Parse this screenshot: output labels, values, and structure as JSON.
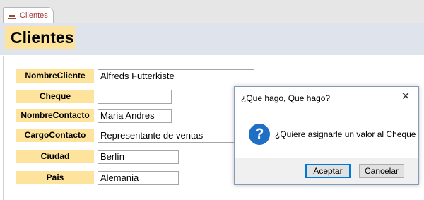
{
  "tab": {
    "label": "Clientes"
  },
  "form": {
    "title": "Clientes",
    "fields": [
      {
        "label": "NombreCliente",
        "value": "Alfreds Futterkiste"
      },
      {
        "label": "Cheque",
        "value": ""
      },
      {
        "label": "NombreContacto",
        "value": "Maria Andres"
      },
      {
        "label": "CargoContacto",
        "value": "Representante de ventas"
      },
      {
        "label": "Ciudad",
        "value": "Berlín"
      },
      {
        "label": "Pais",
        "value": "Alemania"
      }
    ]
  },
  "dialog": {
    "title": "¿Que hago, Que hago?",
    "message": "¿Quiere asignarle un valor al Cheque",
    "icon": "question-icon",
    "close_label": "✕",
    "ok_label": "Aceptar",
    "cancel_label": "Cancelar"
  },
  "colors": {
    "label_bg": "#fde39b",
    "header_bg": "#dfe3ec",
    "tab_text": "#a4373a",
    "question_icon": "#1f6fc5"
  }
}
